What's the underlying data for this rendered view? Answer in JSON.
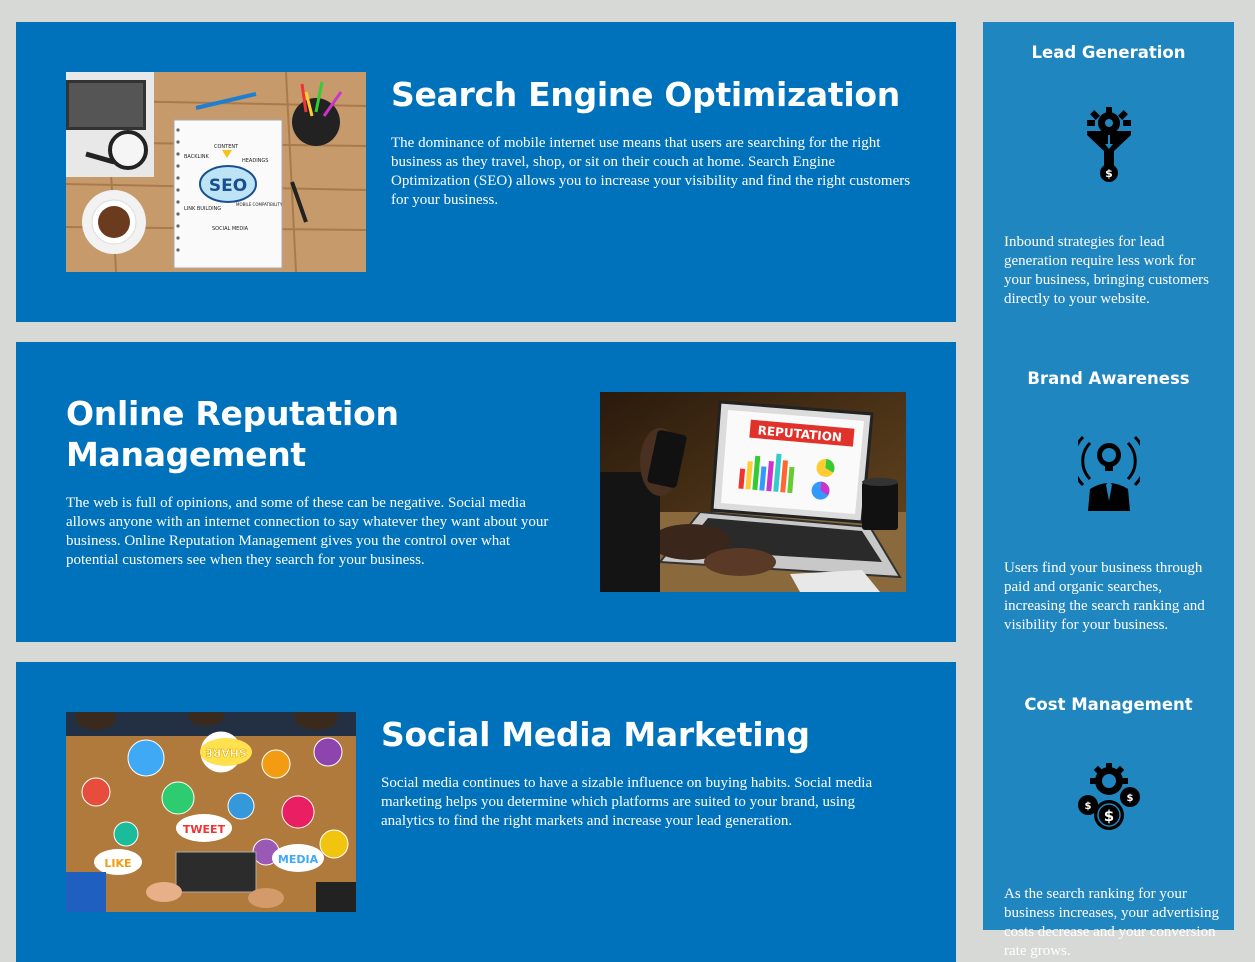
{
  "cards": [
    {
      "title": "Search Engine Optimization",
      "body": "The dominance of mobile internet use means that users are searching for the right business as they travel, shop, or sit on their couch at home. Search Engine Optimization (SEO) allows you to increase your visibility and find the right customers for your business."
    },
    {
      "title": "Online Reputation Management",
      "body": "The web is full of opinions, and some of these can be negative. Social media allows anyone with an internet connection to say whatever they want about your business. Online Reputation Management gives you the control over what potential customers see when they search for your business."
    },
    {
      "title": "Social Media Marketing",
      "body": "Social media continues to have a sizable influence on buying habits. Social media marketing helps you determine which platforms are suited to your brand, using analytics to find the right markets and increase your lead generation."
    }
  ],
  "images": {
    "seo": {
      "labels": [
        "SEO",
        "CONTENT",
        "BACKLINK",
        "HEADINGS",
        "LINK BUILDING",
        "MOBILE COMPATIBILITY",
        "SOCIAL MEDIA"
      ]
    },
    "reputation": {
      "label": "REPUTATION"
    },
    "social": {
      "labels": [
        "SHARE",
        "TWEET",
        "LIKE",
        "MEDIA"
      ]
    }
  },
  "sidebar": {
    "items": [
      {
        "title": "Lead Generation",
        "icon": "funnel-gear-dollar-icon",
        "body": "Inbound strategies for lead generation require less work for your business, bringing customers directly to your website."
      },
      {
        "title": "Brand Awareness",
        "icon": "lightbulb-person-broadcast-icon",
        "body": "Users find your business through paid and organic searches, increasing the search ranking and visibility for your business."
      },
      {
        "title": "Cost Management",
        "icon": "gear-dollar-coins-icon",
        "body": "As the search ranking for your business increases, your advertising costs decrease and your conversion rate grows."
      }
    ]
  },
  "colors": {
    "background": "#d7d9d6",
    "card": "#0072bb",
    "sidebar": "#2086c0",
    "text": "#ffffff"
  }
}
